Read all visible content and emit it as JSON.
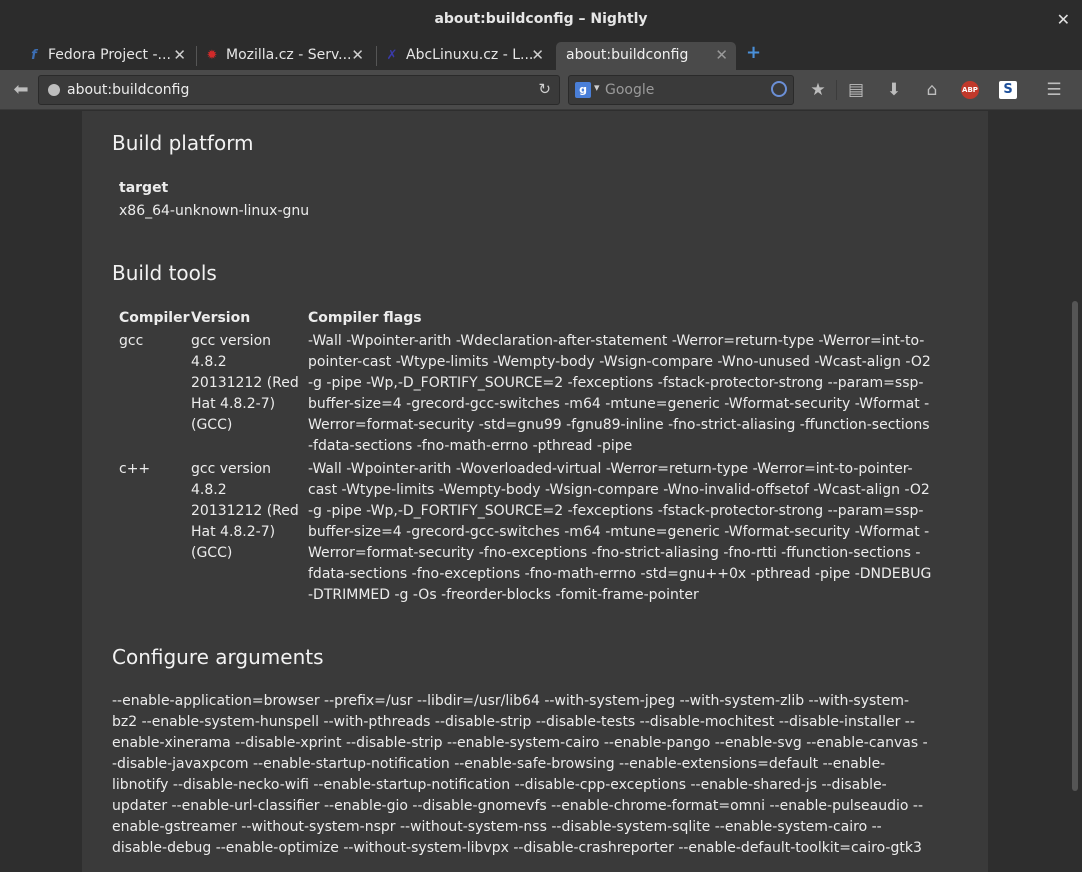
{
  "window": {
    "title": "about:buildconfig – Nightly"
  },
  "tabs": [
    {
      "label": "Fedora Project -...",
      "favicon": "fedora-icon"
    },
    {
      "label": "Mozilla.cz - Serv...",
      "favicon": "mozilla-icon"
    },
    {
      "label": "AbcLinuxu.cz - L...",
      "favicon": "abclinuxu-icon"
    },
    {
      "label": "about:buildconfig",
      "active": true
    }
  ],
  "navbar": {
    "url": "about:buildconfig",
    "search_placeholder": "Google",
    "search_engine_letter": "g",
    "abp_label": "ABP",
    "s_label": "S"
  },
  "content": {
    "build_platform": {
      "heading": "Build platform",
      "target_label": "target",
      "target_value": "x86_64-unknown-linux-gnu"
    },
    "build_tools": {
      "heading": "Build tools",
      "headers": [
        "Compiler",
        "Version",
        "Compiler flags"
      ],
      "rows": [
        {
          "compiler": "gcc",
          "version": "gcc version 4.8.2 20131212 (Red Hat 4.8.2-7) (GCC)",
          "flags": "-Wall -Wpointer-arith -Wdeclaration-after-statement -Werror=return-type -Werror=int-to-pointer-cast -Wtype-limits -Wempty-body -Wsign-compare -Wno-unused -Wcast-align -O2 -g -pipe -Wp,-D_FORTIFY_SOURCE=2 -fexceptions -fstack-protector-strong --param=ssp-buffer-size=4 -grecord-gcc-switches -m64 -mtune=generic -Wformat-security -Wformat -Werror=format-security -std=gnu99 -fgnu89-inline -fno-strict-aliasing -ffunction-sections -fdata-sections -fno-math-errno -pthread -pipe"
        },
        {
          "compiler": "c++",
          "version": "gcc version 4.8.2 20131212 (Red Hat 4.8.2-7) (GCC)",
          "flags": "-Wall -Wpointer-arith -Woverloaded-virtual -Werror=return-type -Werror=int-to-pointer-cast -Wtype-limits -Wempty-body -Wsign-compare -Wno-invalid-offsetof -Wcast-align -O2 -g -pipe -Wp,-D_FORTIFY_SOURCE=2 -fexceptions -fstack-protector-strong --param=ssp-buffer-size=4 -grecord-gcc-switches -m64 -mtune=generic -Wformat-security -Wformat -Werror=format-security -fno-exceptions -fno-strict-aliasing -fno-rtti -ffunction-sections -fdata-sections -fno-exceptions -fno-math-errno -std=gnu++0x -pthread -pipe -DNDEBUG -DTRIMMED -g -Os -freorder-blocks -fomit-frame-pointer"
        }
      ]
    },
    "configure_arguments": {
      "heading": "Configure arguments",
      "text": "--enable-application=browser --prefix=/usr --libdir=/usr/lib64 --with-system-jpeg --with-system-zlib --with-system-bz2 --enable-system-hunspell --with-pthreads --disable-strip --disable-tests --disable-mochitest --disable-installer --enable-xinerama --disable-xprint --disable-strip --enable-system-cairo --enable-pango --enable-svg --enable-canvas --disable-javaxpcom --enable-startup-notification --enable-safe-browsing --enable-extensions=default --enable-libnotify --disable-necko-wifi --enable-startup-notification --disable-cpp-exceptions --enable-shared-js --disable-updater --enable-url-classifier --enable-gio --disable-gnomevfs --enable-chrome-format=omni --enable-pulseaudio --enable-gstreamer --without-system-nspr --without-system-nss --disable-system-sqlite --enable-system-cairo --disable-debug --enable-optimize --without-system-libvpx --disable-crashreporter --enable-default-toolkit=cairo-gtk3"
    }
  }
}
